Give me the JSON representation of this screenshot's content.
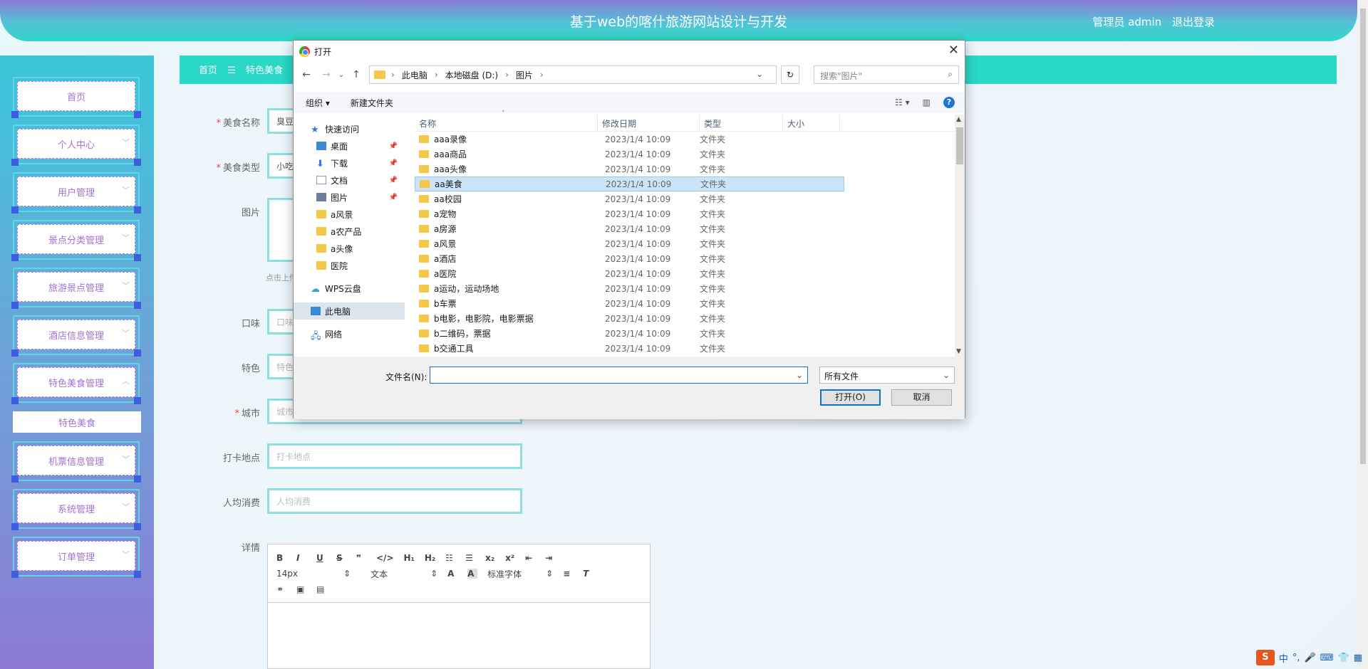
{
  "header": {
    "title": "基于web的喀什旅游网站设计与开发",
    "user": "管理员 admin",
    "logout": "退出登录"
  },
  "sidebar": {
    "items": [
      {
        "label": "首页"
      },
      {
        "label": "个人中心"
      },
      {
        "label": "用户管理"
      },
      {
        "label": "景点分类管理"
      },
      {
        "label": "旅游景点管理"
      },
      {
        "label": "酒店信息管理"
      },
      {
        "label": "特色美食管理"
      },
      {
        "label": "机票信息管理"
      },
      {
        "label": "系统管理"
      },
      {
        "label": "订单管理"
      }
    ],
    "submenu": "特色美食"
  },
  "breadcrumb": {
    "home": "首页",
    "sep": "☰",
    "current": "特色美食"
  },
  "form": {
    "name_label": "美食名称",
    "name_value": "臭豆",
    "type_label": "美食类型",
    "type_value": "小吃",
    "image_label": "图片",
    "upload_tip": "点击上传",
    "taste_label": "口味",
    "taste_ph": "口味",
    "feature_label": "特色",
    "feature_ph": "特色",
    "city_label": "城市",
    "city_ph": "城市",
    "spot_label": "打卡地点",
    "spot_ph": "打卡地点",
    "cost_label": "人均消费",
    "cost_ph": "人均消费",
    "detail_label": "详情"
  },
  "editor": {
    "font_size": "14px",
    "text_type": "文本",
    "font_family": "标准字体"
  },
  "dialog": {
    "title": "打开",
    "path": [
      "此电脑",
      "本地磁盘 (D:)",
      "图片"
    ],
    "search_placeholder": "搜索\"图片\"",
    "organize": "组织 ▾",
    "new_folder": "新建文件夹",
    "tree": [
      {
        "label": "快速访问",
        "icon": "star-icon",
        "color": "#3a7bd5"
      },
      {
        "label": "桌面",
        "icon": "desktop-icon",
        "color": "#3a8ad8"
      },
      {
        "label": "下载",
        "icon": "download-icon",
        "color": "#2f7fd0"
      },
      {
        "label": "文档",
        "icon": "document-icon",
        "color": "#8a9ab0"
      },
      {
        "label": "图片",
        "icon": "picture-icon",
        "color": "#6a7f9c"
      },
      {
        "label": "a风景",
        "icon": "folder-icon",
        "color": "#f5c84a"
      },
      {
        "label": "a农产品",
        "icon": "folder-icon",
        "color": "#f5c84a"
      },
      {
        "label": "a头像",
        "icon": "folder-icon",
        "color": "#f5c84a"
      },
      {
        "label": "医院",
        "icon": "folder-icon",
        "color": "#f5c84a"
      },
      {
        "label": "WPS云盘",
        "icon": "cloud-icon",
        "color": "#3a9ae0"
      },
      {
        "label": "此电脑",
        "icon": "computer-icon",
        "color": "#3a8ad8"
      },
      {
        "label": "网络",
        "icon": "network-icon",
        "color": "#3a8ad8"
      }
    ],
    "columns": [
      "名称",
      "修改日期",
      "类型",
      "大小"
    ],
    "files": [
      {
        "name": "aaa录像",
        "date": "2023/1/4 10:09",
        "type": "文件夹"
      },
      {
        "name": "aaa商品",
        "date": "2023/1/4 10:09",
        "type": "文件夹"
      },
      {
        "name": "aaa头像",
        "date": "2023/1/4 10:09",
        "type": "文件夹"
      },
      {
        "name": "aa美食",
        "date": "2023/1/4 10:09",
        "type": "文件夹"
      },
      {
        "name": "aa校园",
        "date": "2023/1/4 10:09",
        "type": "文件夹"
      },
      {
        "name": "a宠物",
        "date": "2023/1/4 10:09",
        "type": "文件夹"
      },
      {
        "name": "a房源",
        "date": "2023/1/4 10:09",
        "type": "文件夹"
      },
      {
        "name": "a风景",
        "date": "2023/1/4 10:09",
        "type": "文件夹"
      },
      {
        "name": "a酒店",
        "date": "2023/1/4 10:09",
        "type": "文件夹"
      },
      {
        "name": "a医院",
        "date": "2023/1/4 10:09",
        "type": "文件夹"
      },
      {
        "name": "a运动，运动场地",
        "date": "2023/1/4 10:09",
        "type": "文件夹"
      },
      {
        "name": "b车票",
        "date": "2023/1/4 10:09",
        "type": "文件夹"
      },
      {
        "name": "b电影，电影院，电影票据",
        "date": "2023/1/4 10:09",
        "type": "文件夹"
      },
      {
        "name": "b二维码，票据",
        "date": "2023/1/4 10:09",
        "type": "文件夹"
      },
      {
        "name": "b交通工具",
        "date": "2023/1/4 10:09",
        "type": "文件夹"
      }
    ],
    "filename_label": "文件名(N):",
    "filetype": "所有文件",
    "open_btn": "打开(O)",
    "cancel_btn": "取消"
  },
  "ime": {
    "label": "中"
  }
}
